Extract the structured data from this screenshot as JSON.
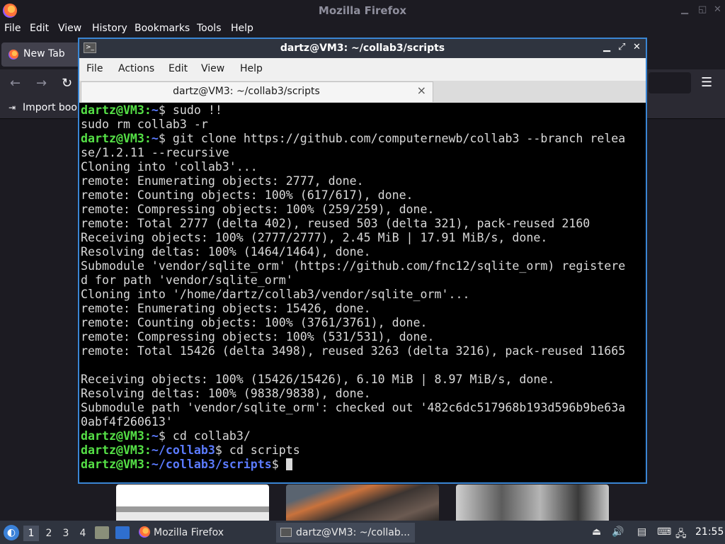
{
  "firefox": {
    "window_title": "Mozilla Firefox",
    "menu": [
      "File",
      "Edit",
      "View",
      "History",
      "Bookmarks",
      "Tools",
      "Help"
    ],
    "tab_label": "New Tab",
    "bookmark_import": "Import book"
  },
  "terminal": {
    "window_title": "dartz@VM3: ~/collab3/scripts",
    "menu": [
      "File",
      "Actions",
      "Edit",
      "View",
      "Help"
    ],
    "tab_title": "dartz@VM3: ~/collab3/scripts",
    "prompt_user": "dartz@VM3",
    "lines": [
      {
        "type": "prompt",
        "path": "~",
        "cmd": " sudo !!"
      },
      {
        "type": "out",
        "text": "sudo rm collab3 -r"
      },
      {
        "type": "prompt",
        "path": "~",
        "cmd": " git clone https://github.com/computernewb/collab3 --branch relea"
      },
      {
        "type": "out",
        "text": "se/1.2.11 --recursive"
      },
      {
        "type": "out",
        "text": "Cloning into 'collab3'..."
      },
      {
        "type": "out",
        "text": "remote: Enumerating objects: 2777, done."
      },
      {
        "type": "out",
        "text": "remote: Counting objects: 100% (617/617), done."
      },
      {
        "type": "out",
        "text": "remote: Compressing objects: 100% (259/259), done."
      },
      {
        "type": "out",
        "text": "remote: Total 2777 (delta 402), reused 503 (delta 321), pack-reused 2160"
      },
      {
        "type": "out",
        "text": "Receiving objects: 100% (2777/2777), 2.45 MiB | 17.91 MiB/s, done."
      },
      {
        "type": "out",
        "text": "Resolving deltas: 100% (1464/1464), done."
      },
      {
        "type": "out",
        "text": "Submodule 'vendor/sqlite_orm' (https://github.com/fnc12/sqlite_orm) registere"
      },
      {
        "type": "out",
        "text": "d for path 'vendor/sqlite_orm'"
      },
      {
        "type": "out",
        "text": "Cloning into '/home/dartz/collab3/vendor/sqlite_orm'..."
      },
      {
        "type": "out",
        "text": "remote: Enumerating objects: 15426, done."
      },
      {
        "type": "out",
        "text": "remote: Counting objects: 100% (3761/3761), done."
      },
      {
        "type": "out",
        "text": "remote: Compressing objects: 100% (531/531), done."
      },
      {
        "type": "out",
        "text": "remote: Total 15426 (delta 3498), reused 3263 (delta 3216), pack-reused 11665"
      },
      {
        "type": "out",
        "text": ""
      },
      {
        "type": "out",
        "text": "Receiving objects: 100% (15426/15426), 6.10 MiB | 8.97 MiB/s, done."
      },
      {
        "type": "out",
        "text": "Resolving deltas: 100% (9838/9838), done."
      },
      {
        "type": "out",
        "text": "Submodule path 'vendor/sqlite_orm': checked out '482c6dc517968b193d596b9be63a"
      },
      {
        "type": "out",
        "text": "0abf4f260613'"
      },
      {
        "type": "prompt",
        "path": "~",
        "cmd": " cd collab3/"
      },
      {
        "type": "prompt",
        "path": "~/collab3",
        "cmd": " cd scripts"
      },
      {
        "type": "prompt",
        "path": "~/collab3/scripts",
        "cmd": " ",
        "cursor": true
      }
    ]
  },
  "taskbar": {
    "workspaces": [
      "1",
      "2",
      "3",
      "4"
    ],
    "tasks": [
      "Mozilla Firefox",
      "dartz@VM3: ~/collab..."
    ],
    "clock": "21:55"
  }
}
